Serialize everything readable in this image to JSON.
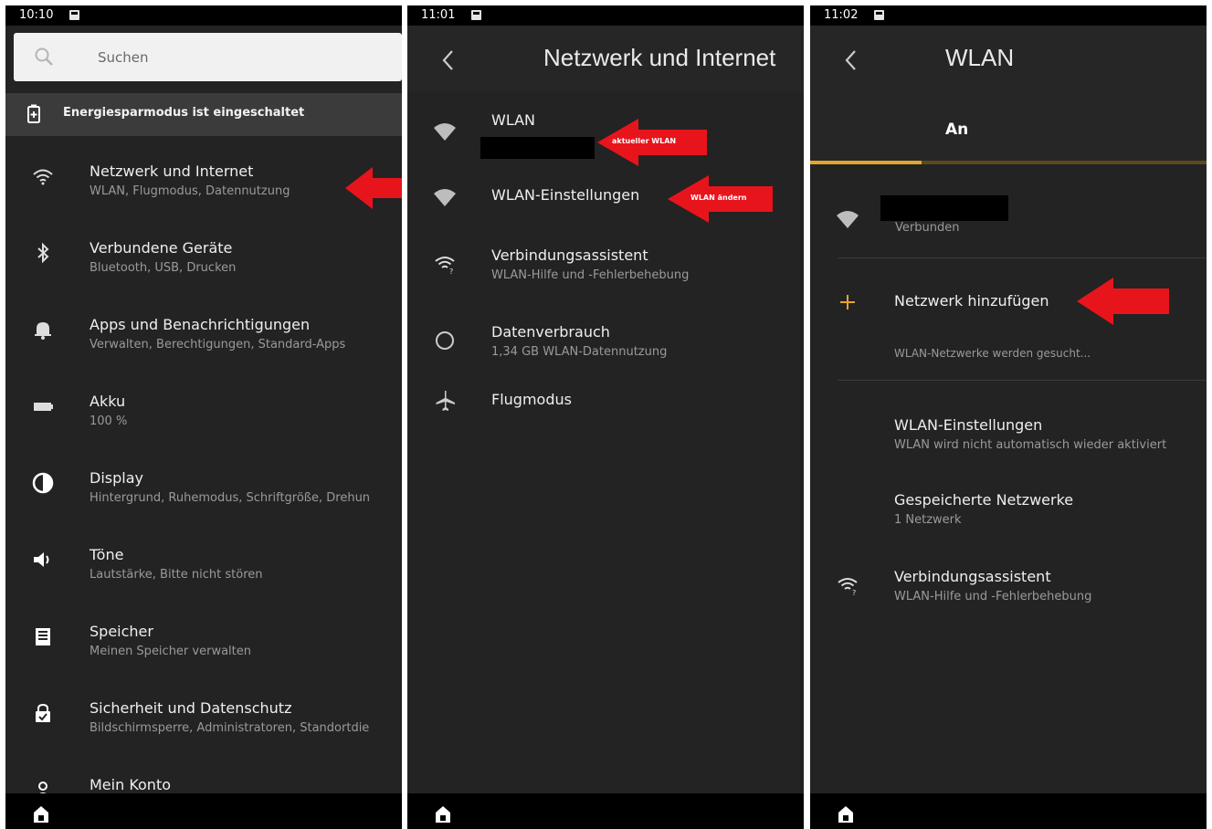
{
  "panel1": {
    "time": "10:10",
    "search_placeholder": "Suchen",
    "battery_saver": "Energiesparmodus ist eingeschaltet",
    "items": [
      {
        "title": "Netzwerk und Internet",
        "subtitle": "WLAN, Flugmodus, Datennutzung",
        "icon": "wifi-icon"
      },
      {
        "title": "Verbundene Geräte",
        "subtitle": "Bluetooth, USB, Drucken",
        "icon": "bluetooth-icon"
      },
      {
        "title": "Apps und Benachrichtigungen",
        "subtitle": "Verwalten, Berechtigungen, Standard-Apps",
        "icon": "bell-icon"
      },
      {
        "title": "Akku",
        "subtitle": "100 %",
        "icon": "battery-icon"
      },
      {
        "title": "Display",
        "subtitle": "Hintergrund, Ruhemodus, Schriftgröße, Drehun",
        "icon": "contrast-icon"
      },
      {
        "title": "Töne",
        "subtitle": "Lautstärke, Bitte nicht stören",
        "icon": "speaker-icon"
      },
      {
        "title": "Speicher",
        "subtitle": "Meinen Speicher verwalten",
        "icon": "storage-icon"
      },
      {
        "title": "Sicherheit und Datenschutz",
        "subtitle": "Bildschirmsperre, Administratoren, Standortdie",
        "icon": "lock-icon"
      },
      {
        "title": "Mein Konto",
        "subtitle": "",
        "icon": "account-icon"
      }
    ]
  },
  "panel2": {
    "time": "11:01",
    "title": "Netzwerk und Internet",
    "items": [
      {
        "title": "WLAN",
        "subtitle": "",
        "icon": "wifi-icon"
      },
      {
        "title": "WLAN-Einstellungen",
        "subtitle": "",
        "icon": "wifi-icon"
      },
      {
        "title": "Verbindungsassistent",
        "subtitle": "WLAN-Hilfe und -Fehlerbehebung",
        "icon": "wifi-assistant-icon"
      },
      {
        "title": "Datenverbrauch",
        "subtitle": "1,34 GB WLAN-Datennutzung",
        "icon": "data-usage-icon"
      },
      {
        "title": "Flugmodus",
        "subtitle": "",
        "icon": "airplane-icon"
      }
    ],
    "annotations": {
      "current_wlan": "aktueller WLAN",
      "change_wlan": "WLAN ändern"
    }
  },
  "panel3": {
    "time": "11:02",
    "title": "WLAN",
    "toggle_label": "An",
    "connected_status": "Verbunden",
    "add_network": "Netzwerk hinzufügen",
    "searching": "WLAN-Netzwerke werden gesucht...",
    "items": [
      {
        "title": "WLAN-Einstellungen",
        "subtitle": "WLAN wird nicht automatisch wieder aktiviert"
      },
      {
        "title": "Gespeicherte Netzwerke",
        "subtitle": "1 Netzwerk"
      },
      {
        "title": "Verbindungsassistent",
        "subtitle": "WLAN-Hilfe und -Fehlerbehebung"
      }
    ]
  },
  "colors": {
    "background": "#232323",
    "accent": "#e4a52d",
    "annotation_red": "#e8141c"
  }
}
